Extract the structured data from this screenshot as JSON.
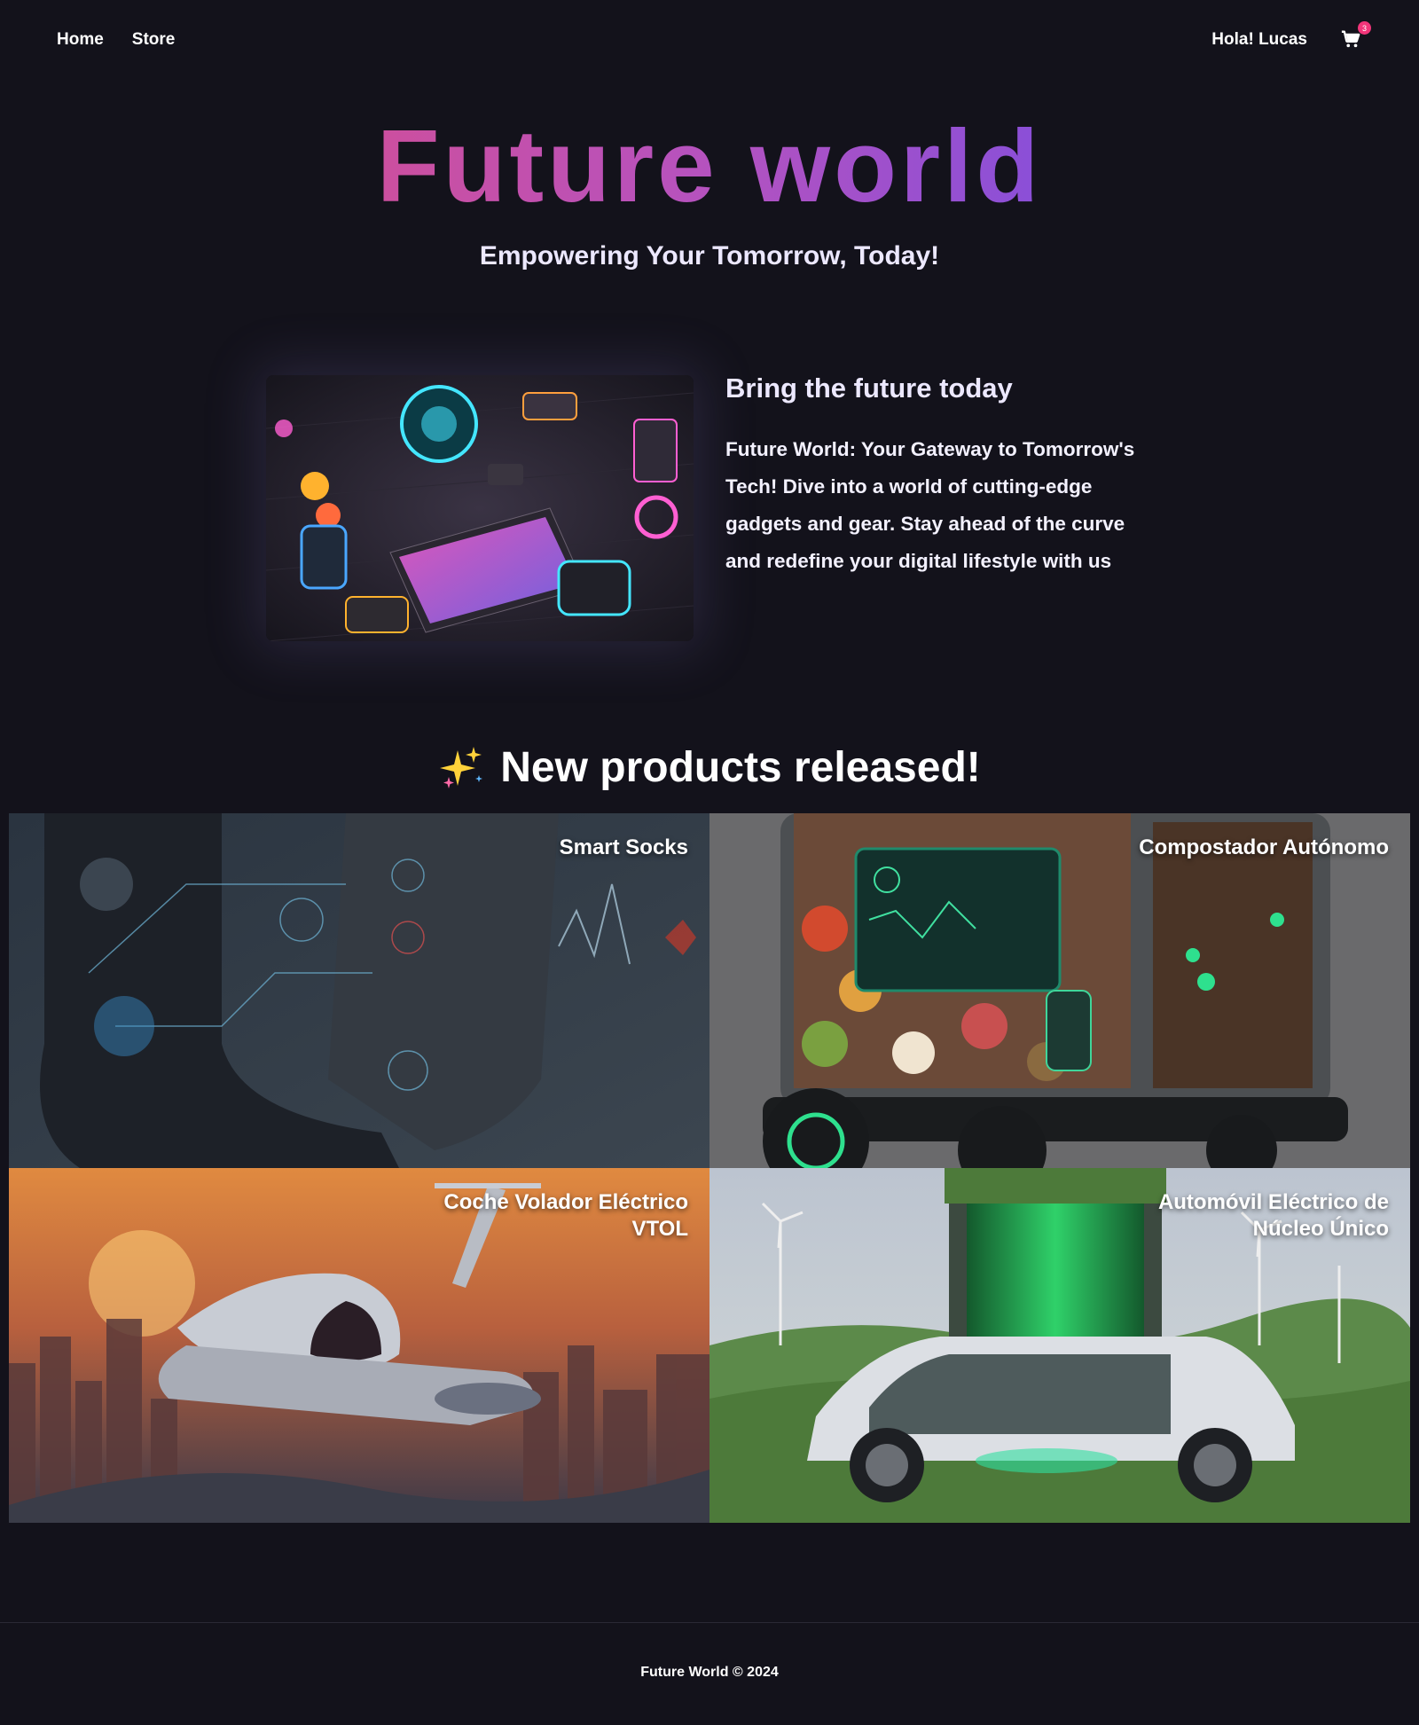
{
  "nav": {
    "home": "Home",
    "store": "Store",
    "greeting": "Hola! Lucas",
    "cart_icon": "shopping-cart-icon",
    "cart_count": "3"
  },
  "hero": {
    "title": "Future world",
    "subtitle": "Empowering Your Tomorrow, Today!"
  },
  "feature": {
    "title": "Bring the future today",
    "text": "Future World: Your Gateway to Tomorrow's Tech! Dive into a world of cutting-edge gadgets and gear. Stay ahead of the curve and redefine your digital lifestyle with us"
  },
  "new_products": {
    "icon": "sparkles-icon",
    "title": "New products released!",
    "items": [
      {
        "name": "Smart Socks"
      },
      {
        "name": "Compostador Autónomo"
      },
      {
        "name": "Coche Volador Eléctrico VTOL"
      },
      {
        "name": "Automóvil Eléctrico de Núcleo Único"
      }
    ]
  },
  "footer": {
    "text": "Future World © 2024"
  },
  "colors": {
    "background": "#13121b",
    "title_gradient_start": "#cc4f9f",
    "title_gradient_end": "#8a4fd8",
    "badge": "#f2357a"
  }
}
